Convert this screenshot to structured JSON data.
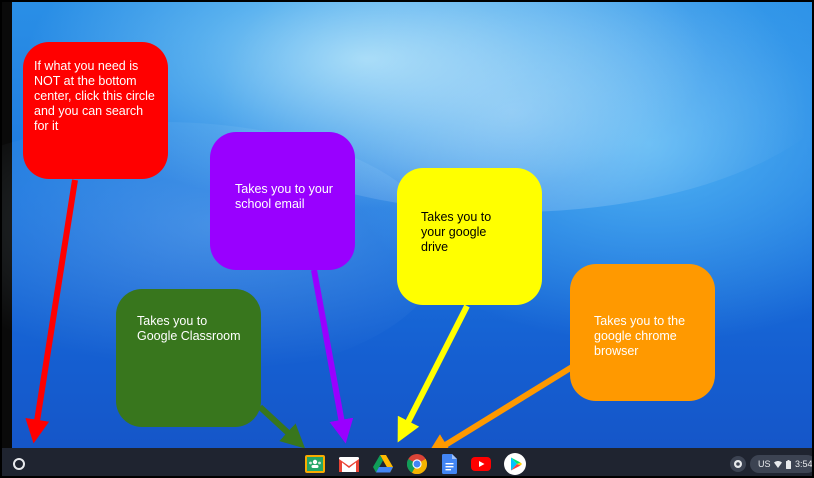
{
  "callouts": {
    "search": "If what you need is NOT at the bottom center, click this circle and you can search for it",
    "gmail": "Takes you to your school email",
    "drive": "Takes you to your google drive",
    "classroom": "Takes you to Google Classroom",
    "chrome": "Takes you to the google chrome browser"
  },
  "colors": {
    "search": "#ff0000",
    "gmail": "#9900ff",
    "drive": "#ffff00",
    "classroom": "#38761d",
    "chrome": "#ff9900",
    "shelf": "#1f2430"
  },
  "shelf": {
    "apps": [
      {
        "name": "google-classroom-icon"
      },
      {
        "name": "gmail-icon"
      },
      {
        "name": "google-drive-icon"
      },
      {
        "name": "chrome-icon"
      },
      {
        "name": "google-docs-icon"
      },
      {
        "name": "youtube-icon"
      },
      {
        "name": "play-store-icon"
      }
    ],
    "status": {
      "locale": "US",
      "time": "3:54"
    }
  }
}
